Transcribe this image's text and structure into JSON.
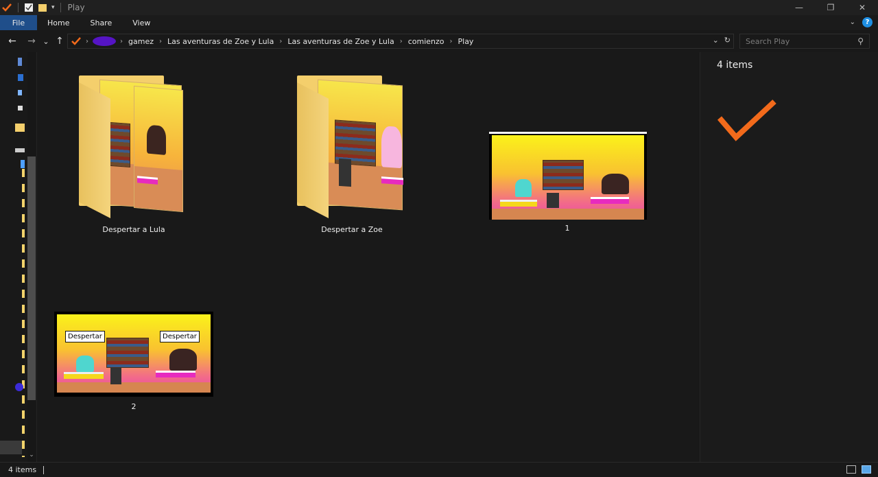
{
  "window": {
    "title": "Play",
    "controls": {
      "minimize": "—",
      "maximize": "❐",
      "close": "✕"
    }
  },
  "ribbon": {
    "tabs": [
      {
        "label": "File"
      },
      {
        "label": "Home"
      },
      {
        "label": "Share"
      },
      {
        "label": "View"
      }
    ],
    "help": "?"
  },
  "nav": {
    "back": "←",
    "forward": "→",
    "recent": "⌄",
    "up": "↑"
  },
  "address": {
    "crumbs": [
      "gamez",
      "Las aventuras de Zoe y Lula",
      "Las aventuras de Zoe y Lula",
      "comienzo",
      "Play"
    ],
    "separator": "›"
  },
  "search": {
    "placeholder": "Search Play"
  },
  "items": [
    {
      "label": "Despertar a Lula",
      "kind": "folder"
    },
    {
      "label": "Despertar a Zoe",
      "kind": "folder"
    },
    {
      "label": "1",
      "kind": "image"
    },
    {
      "label": "2",
      "kind": "image",
      "tags": [
        "Despertar",
        "Despertar"
      ]
    }
  ],
  "preview": {
    "count_label": "4 items",
    "check_color": "#f26a1b"
  },
  "status": {
    "count_label": "4 items"
  },
  "colors": {
    "file_tab": "#1f4e8a",
    "accent_check": "#f26a1b",
    "help": "#1e8fe3",
    "blob": "#5514c4"
  }
}
